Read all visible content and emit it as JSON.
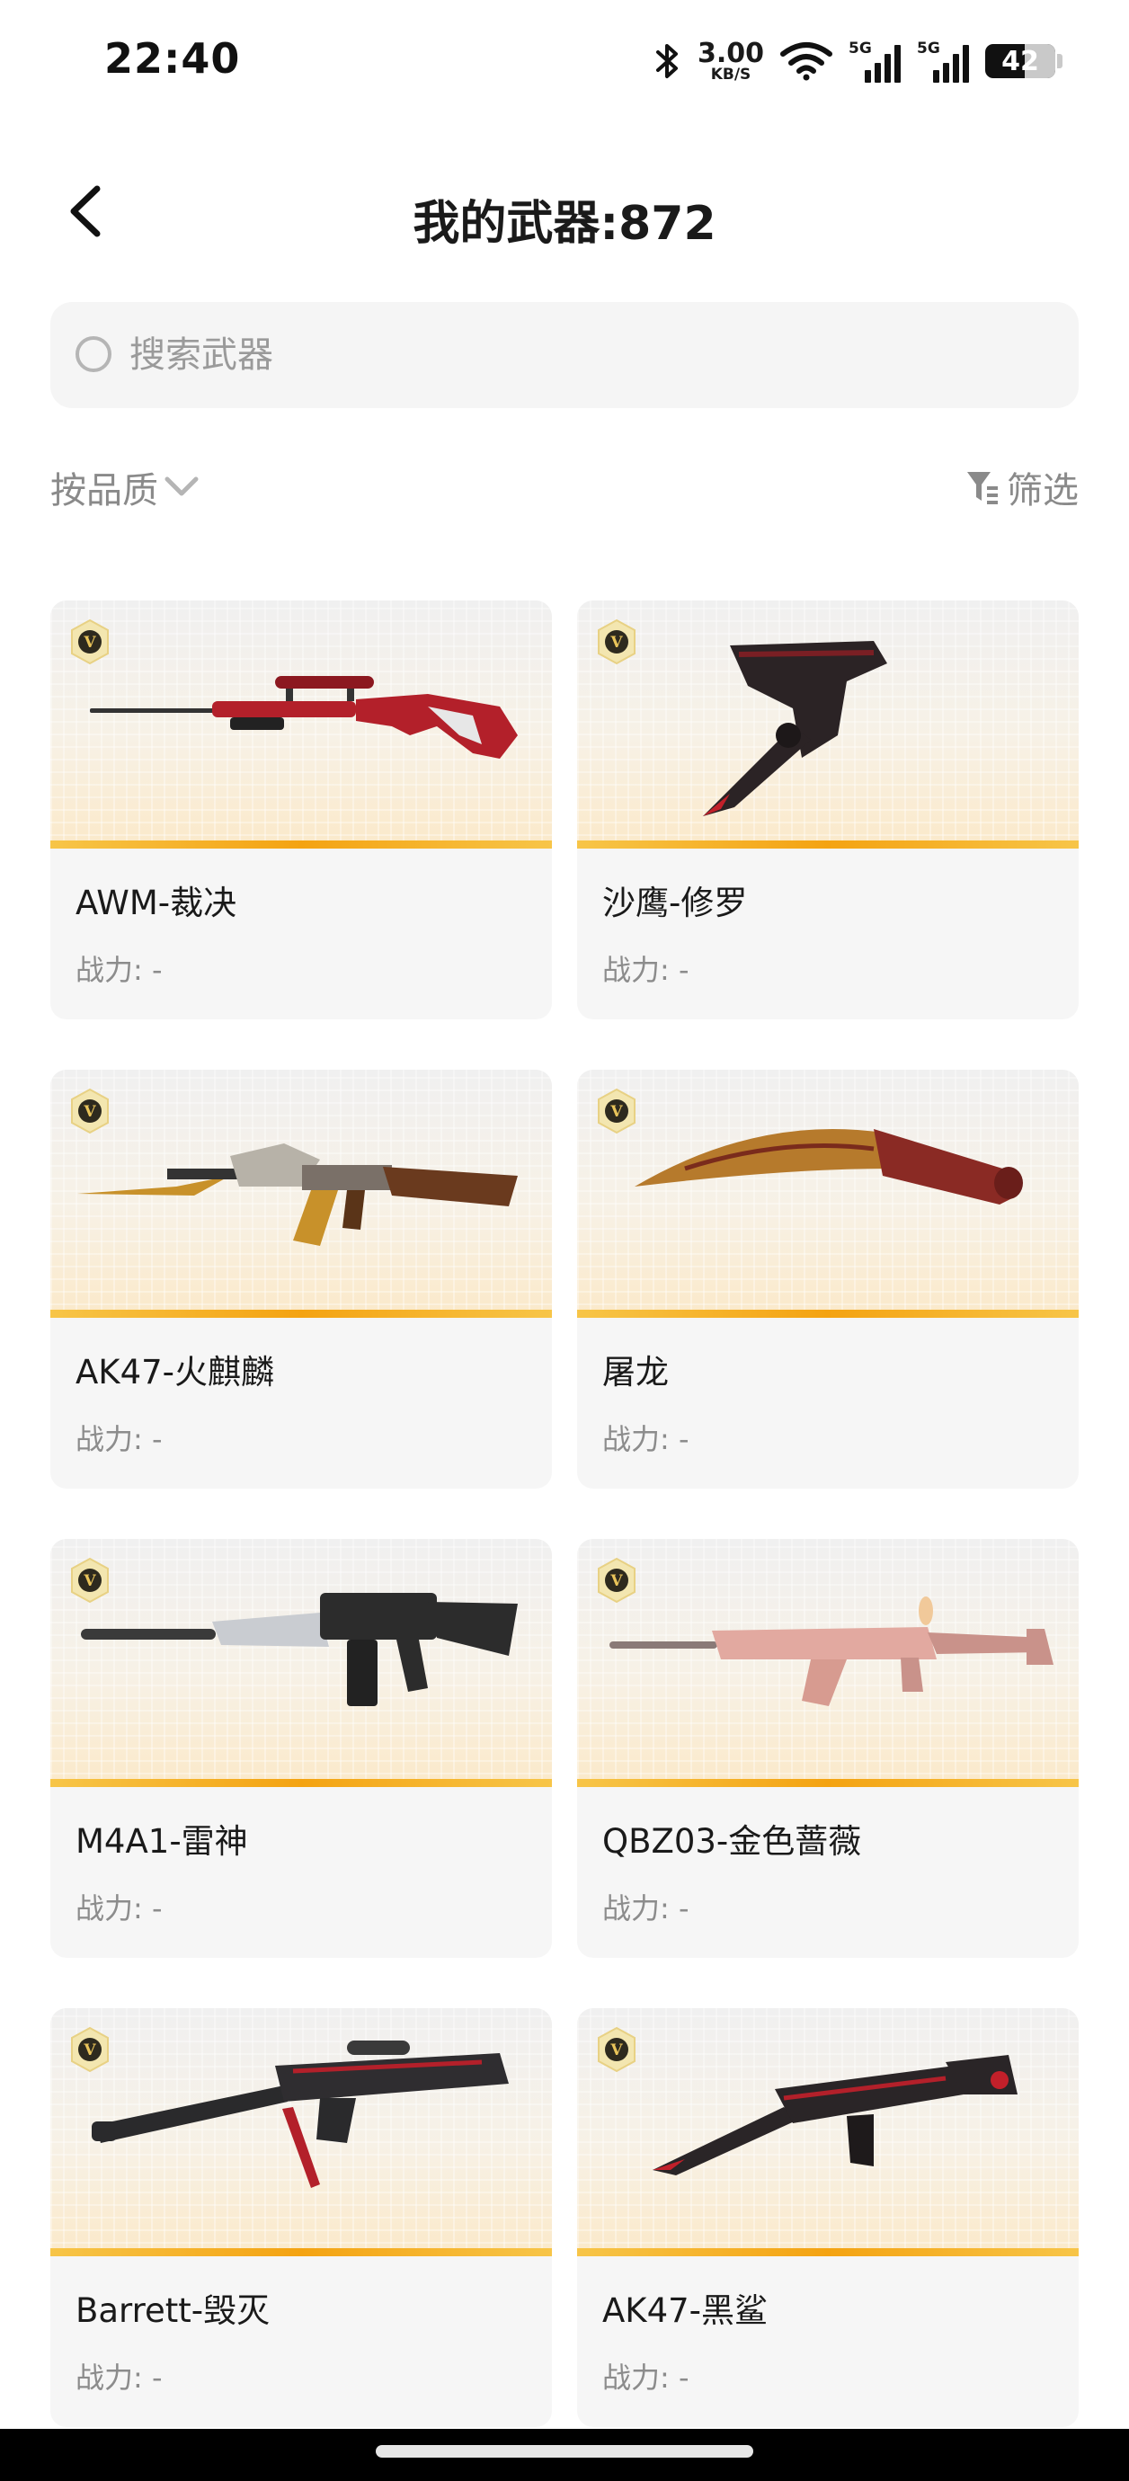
{
  "status_bar": {
    "time": "22:40",
    "net_speed_value": "3.00",
    "net_speed_unit": "KB/S",
    "sim1_type": "5G",
    "sim2_type": "5G",
    "battery_level": "42",
    "icons": [
      "bluetooth-icon",
      "wifi-icon",
      "signal-icon",
      "battery-icon"
    ]
  },
  "header": {
    "title": "我的武器:872",
    "back_icon": "chevron-left-icon"
  },
  "search": {
    "placeholder": "搜索武器",
    "value": ""
  },
  "toolbar": {
    "sort_label": "按品质",
    "filter_label": "筛选"
  },
  "weapons": [
    {
      "name": "AWM-裁决",
      "power": "战力: -",
      "badge": "V"
    },
    {
      "name": "沙鹰-修罗",
      "power": "战力: -",
      "badge": "V"
    },
    {
      "name": "AK47-火麒麟",
      "power": "战力: -",
      "badge": "V"
    },
    {
      "name": "屠龙",
      "power": "战力: -",
      "badge": "V"
    },
    {
      "name": "M4A1-雷神",
      "power": "战力: -",
      "badge": "V"
    },
    {
      "name": "QBZ03-金色蔷薇",
      "power": "战力: -",
      "badge": "V"
    },
    {
      "name": "Barrett-毁灭",
      "power": "战力: -",
      "badge": "V"
    },
    {
      "name": "AK47-黑鲨",
      "power": "战力: -",
      "badge": "V"
    }
  ],
  "colors": {
    "accent_strip": "#f4a312",
    "card_bg": "#f6f6f6",
    "muted_text": "#8c8c8c"
  }
}
